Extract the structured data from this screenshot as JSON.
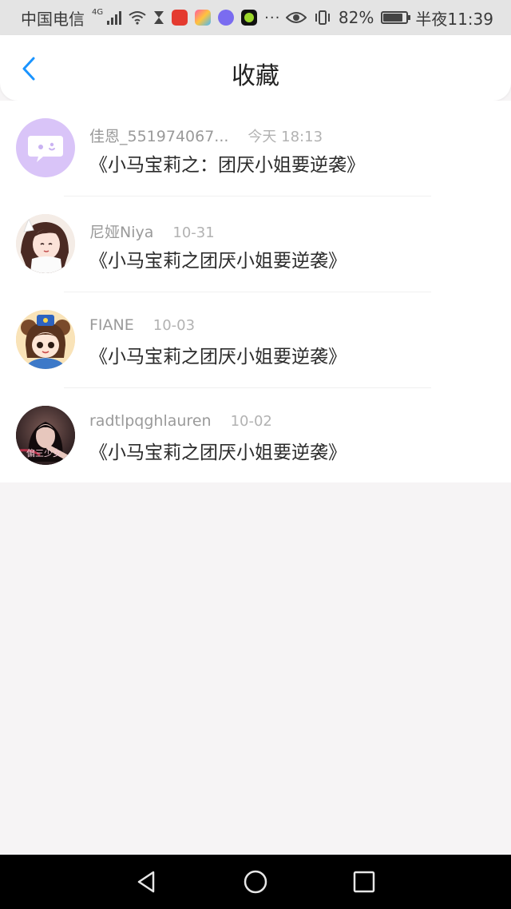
{
  "status_bar": {
    "carrier": "中国电信",
    "network": "4G",
    "battery": "82%",
    "time": "半夜11:39",
    "more": "···",
    "app_icons": [
      "hearing-app-icon",
      "colorful-app-icon",
      "music-app-icon",
      "green-app-icon"
    ],
    "app_colors": [
      "#e43a2f",
      "#ff8a3d",
      "#7a6cf0",
      "#111111"
    ]
  },
  "header": {
    "title": "收藏"
  },
  "favorites": [
    {
      "author": "佳恩_551974067...",
      "time": "今天 18:13",
      "title": "《小马宝莉之：团厌小姐要逆袭》",
      "avatar": "chat-bubble-avatar"
    },
    {
      "author": "尼娅Niya",
      "time": "10-31",
      "title": "《小马宝莉之团厌小姐要逆袭》",
      "avatar": "anime-girl-avatar"
    },
    {
      "author": "FIANE",
      "time": "10-03",
      "title": "《小马宝莉之团厌小姐要逆袭》",
      "avatar": "cartoon-girl-avatar"
    },
    {
      "author": "radtlpqghlauren",
      "time": "10-02",
      "title": "《小马宝莉之团厌小姐要逆袭》",
      "avatar": "photo-avatar"
    }
  ],
  "avatar_text": {
    "photo": "偏三少女"
  },
  "colors": {
    "accent": "#1a94ff",
    "list_bg": "#ffffff",
    "page_bg": "#f6f4f5"
  }
}
